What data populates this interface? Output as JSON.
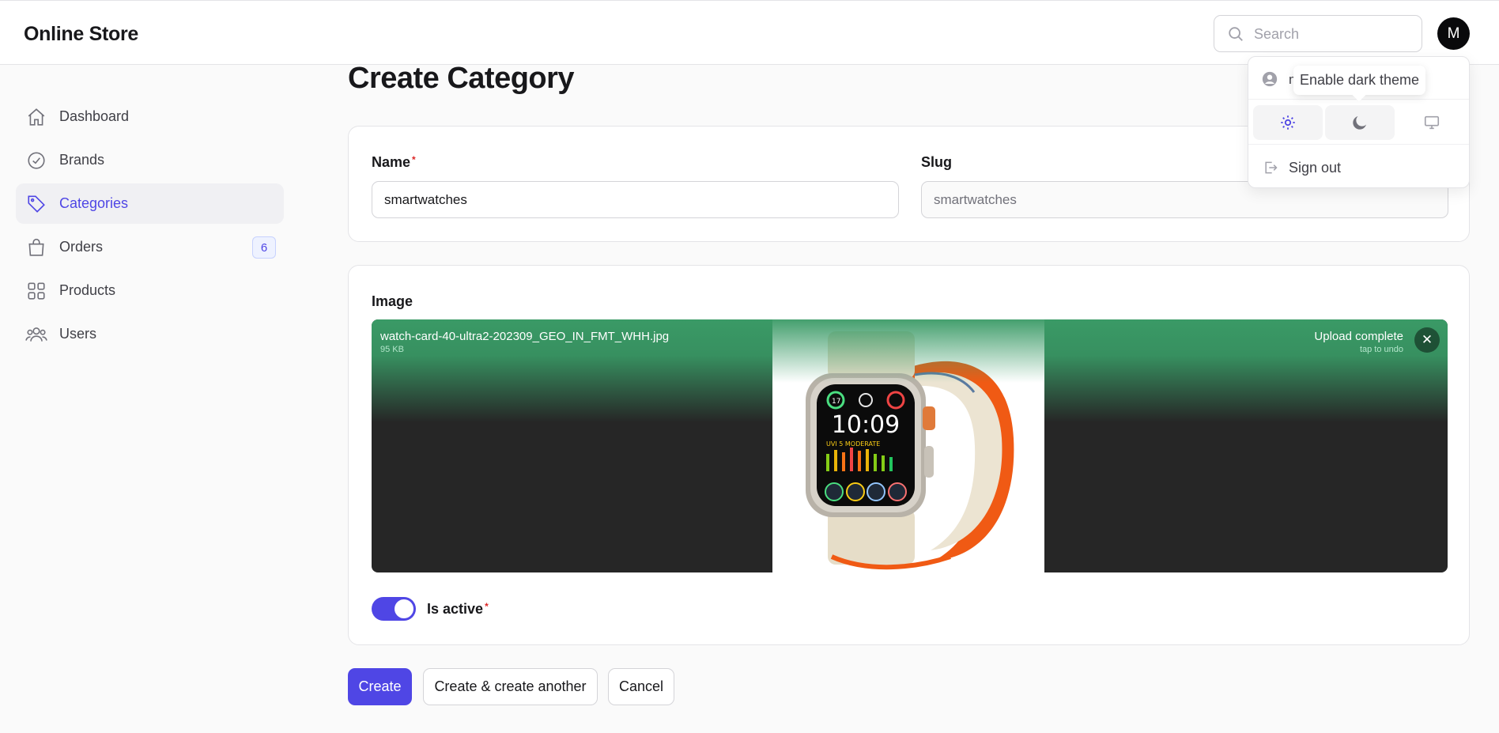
{
  "app": {
    "title": "Online Store"
  },
  "search": {
    "placeholder": "Search"
  },
  "avatar": {
    "initial": "M"
  },
  "sidebar": {
    "items": [
      {
        "label": "Dashboard",
        "icon": "home-icon",
        "active": false
      },
      {
        "label": "Brands",
        "icon": "check-badge-icon",
        "active": false
      },
      {
        "label": "Categories",
        "icon": "tag-icon",
        "active": true
      },
      {
        "label": "Orders",
        "icon": "shopping-bag-icon",
        "active": false,
        "badge": "6"
      },
      {
        "label": "Products",
        "icon": "squares-icon",
        "active": false
      },
      {
        "label": "Users",
        "icon": "users-icon",
        "active": false
      }
    ]
  },
  "page": {
    "title": "Create Category"
  },
  "form": {
    "name": {
      "label": "Name",
      "value": "smartwatches",
      "required_mark": "*"
    },
    "slug": {
      "label": "Slug",
      "value": "smartwatches"
    },
    "image": {
      "label": "Image",
      "file_name": "watch-card-40-ultra2-202309_GEO_IN_FMT_WHH.jpg",
      "file_size": "95 KB",
      "status": "Upload complete",
      "undo_hint": "tap to undo",
      "remove_label": "✕"
    },
    "is_active": {
      "label": "Is active",
      "required_mark": "*",
      "value": true
    },
    "actions": {
      "create": "Create",
      "create_another": "Create & create another",
      "cancel": "Cancel"
    }
  },
  "user_menu": {
    "user_initial": "m",
    "theme_tooltip": "Enable dark theme",
    "sign_out": "Sign out"
  },
  "watch_face": {
    "time": "10:09",
    "complication": "UVI 5 MODERATE",
    "top_left": "17"
  },
  "colors": {
    "accent": "#4f46e5",
    "upload_success": "#3a9a66",
    "required": "#dc2626"
  }
}
